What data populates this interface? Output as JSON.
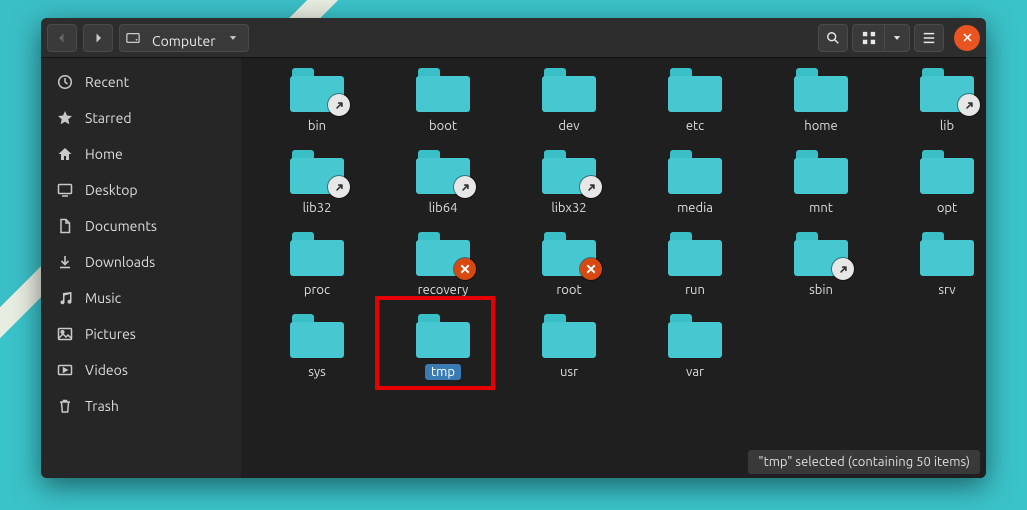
{
  "header": {
    "path_label": "Computer"
  },
  "sidebar": {
    "items": [
      {
        "label": "Recent"
      },
      {
        "label": "Starred"
      },
      {
        "label": "Home"
      },
      {
        "label": "Desktop"
      },
      {
        "label": "Documents"
      },
      {
        "label": "Downloads"
      },
      {
        "label": "Music"
      },
      {
        "label": "Pictures"
      },
      {
        "label": "Videos"
      },
      {
        "label": "Trash"
      }
    ]
  },
  "folders": [
    {
      "label": "bin",
      "badge": "symlink"
    },
    {
      "label": "boot",
      "badge": null
    },
    {
      "label": "dev",
      "badge": null
    },
    {
      "label": "etc",
      "badge": null
    },
    {
      "label": "home",
      "badge": null
    },
    {
      "label": "lib",
      "badge": "symlink"
    },
    {
      "label": "lib32",
      "badge": "symlink"
    },
    {
      "label": "lib64",
      "badge": "symlink"
    },
    {
      "label": "libx32",
      "badge": "symlink"
    },
    {
      "label": "media",
      "badge": null
    },
    {
      "label": "mnt",
      "badge": null
    },
    {
      "label": "opt",
      "badge": null
    },
    {
      "label": "proc",
      "badge": null
    },
    {
      "label": "recovery",
      "badge": "noaccess"
    },
    {
      "label": "root",
      "badge": "noaccess"
    },
    {
      "label": "run",
      "badge": null
    },
    {
      "label": "sbin",
      "badge": "symlink"
    },
    {
      "label": "srv",
      "badge": null
    },
    {
      "label": "sys",
      "badge": null
    },
    {
      "label": "tmp",
      "badge": null,
      "selected": true,
      "highlighted": true
    },
    {
      "label": "usr",
      "badge": null
    },
    {
      "label": "var",
      "badge": null
    }
  ],
  "status": {
    "text": "\"tmp\" selected  (containing 50 items)"
  }
}
